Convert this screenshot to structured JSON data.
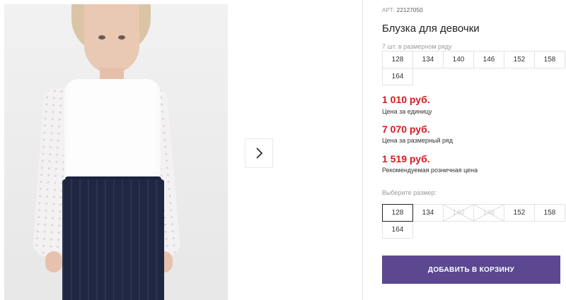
{
  "product": {
    "article_label": "АРТ:",
    "article_value": "22127050",
    "title": "Блузка для девочки",
    "sizes_in_row_note": "7 шт. в размерном ряду",
    "size_row": [
      "128",
      "134",
      "140",
      "146",
      "152",
      "158",
      "164"
    ]
  },
  "prices": {
    "unit_price": "1 010 руб.",
    "unit_price_label": "Цена за единицу",
    "row_price": "7 070 руб.",
    "row_price_label": "Цена за размерный ряд",
    "retail_price": "1 519 руб.",
    "retail_price_label": "Рекомендуемая розничная цена",
    "price_color": "#d71920"
  },
  "size_select": {
    "label": "Выберите размер:",
    "options": [
      {
        "value": "128",
        "selected": true,
        "available": true
      },
      {
        "value": "134",
        "selected": false,
        "available": true
      },
      {
        "value": "140",
        "selected": false,
        "available": false
      },
      {
        "value": "146",
        "selected": false,
        "available": false
      },
      {
        "value": "152",
        "selected": false,
        "available": true
      },
      {
        "value": "158",
        "selected": false,
        "available": true
      },
      {
        "value": "164",
        "selected": false,
        "available": true
      }
    ]
  },
  "cart_button": {
    "label": "ДОБАВИТЬ В КОРЗИНУ",
    "color": "#5b4890"
  },
  "gallery": {
    "next_icon": "chevron-right-icon"
  }
}
